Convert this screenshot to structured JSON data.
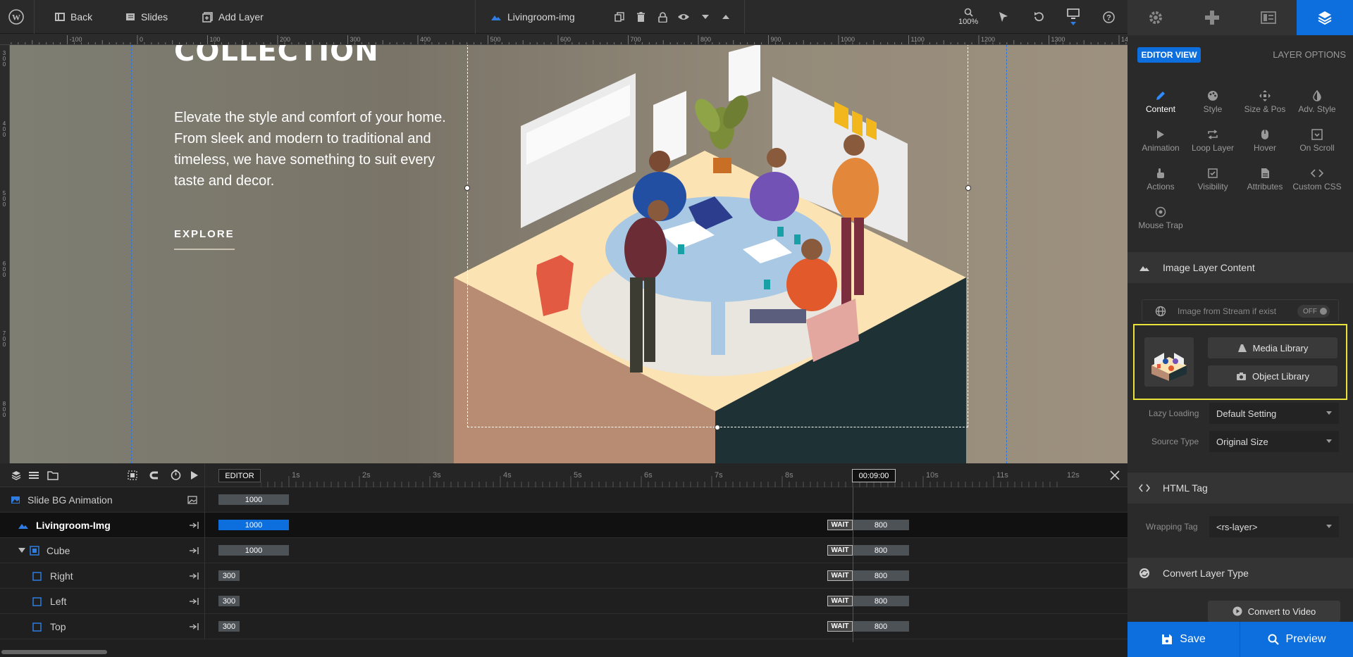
{
  "topbar": {
    "back_label": "Back",
    "slides_label": "Slides",
    "add_layer_label": "Add Layer",
    "layer_name": "Livingroom-img",
    "zoom": "100%"
  },
  "ruler": {
    "labels": [
      "-100",
      "0",
      "100",
      "200",
      "300",
      "400",
      "500",
      "600",
      "700",
      "800",
      "900",
      "1000",
      "1100",
      "1200",
      "1300",
      "14"
    ],
    "left_labels": [
      "300",
      "400",
      "500",
      "600",
      "700",
      "800"
    ]
  },
  "canvas": {
    "heading": "COLLECTION",
    "body": "Elevate the style and comfort of your home. From sleek and modern to traditional and timeless, we have something to suit every taste and decor.",
    "cta": "EXPLORE"
  },
  "timeline": {
    "editor_label": "EDITOR",
    "ticks": [
      "1s",
      "2s",
      "3s",
      "4s",
      "5s",
      "6s",
      "7s",
      "8s",
      "9s",
      "10s",
      "11s",
      "12s"
    ],
    "playhead_time": "00:09:00",
    "wait_label": "WAIT",
    "rows": [
      {
        "name": "Slide BG Animation",
        "start_value": "1000"
      },
      {
        "name": "Livingroom-Img",
        "start_value": "1000",
        "end_value": "800"
      },
      {
        "name": "Cube",
        "start_value": "1000",
        "end_value": "800"
      },
      {
        "name": "Right",
        "start_value": "300",
        "end_value": "800"
      },
      {
        "name": "Left",
        "start_value": "300",
        "end_value": "800"
      },
      {
        "name": "Top",
        "start_value": "300",
        "end_value": "800"
      }
    ]
  },
  "sidebar": {
    "editor_view": "EDITOR VIEW",
    "layer_options": "LAYER OPTIONS",
    "options": [
      {
        "label": "Content",
        "icon": "pencil-icon"
      },
      {
        "label": "Style",
        "icon": "palette-icon"
      },
      {
        "label": "Size & Pos",
        "icon": "move-icon"
      },
      {
        "label": "Adv. Style",
        "icon": "contrast-icon"
      },
      {
        "label": "Animation",
        "icon": "play-icon"
      },
      {
        "label": "Loop Layer",
        "icon": "loop-icon"
      },
      {
        "label": "Hover",
        "icon": "mouse-icon"
      },
      {
        "label": "On Scroll",
        "icon": "scroll-icon"
      },
      {
        "label": "Actions",
        "icon": "pointer-icon"
      },
      {
        "label": "Visibility",
        "icon": "eye-icon"
      },
      {
        "label": "Attributes",
        "icon": "file-icon"
      },
      {
        "label": "Custom CSS",
        "icon": "code-icon"
      },
      {
        "label": "Mouse Trap",
        "icon": "target-icon"
      }
    ],
    "image_section": "Image Layer Content",
    "stream_label": "Image from Stream if exist",
    "stream_toggle": "OFF",
    "media_library": "Media Library",
    "object_library": "Object Library",
    "lazy_loading_label": "Lazy Loading",
    "lazy_loading_value": "Default Setting",
    "source_type_label": "Source Type",
    "source_type_value": "Original Size",
    "html_tag_section": "HTML Tag",
    "wrapping_tag_label": "Wrapping Tag",
    "wrapping_tag_value": "<rs-layer>",
    "convert_section": "Convert Layer Type",
    "convert_video": "Convert to Video",
    "save": "Save",
    "preview": "Preview"
  },
  "colors": {
    "accent": "#0d6fde",
    "highlight": "#e8e23a",
    "panel": "#2a2a2b"
  }
}
